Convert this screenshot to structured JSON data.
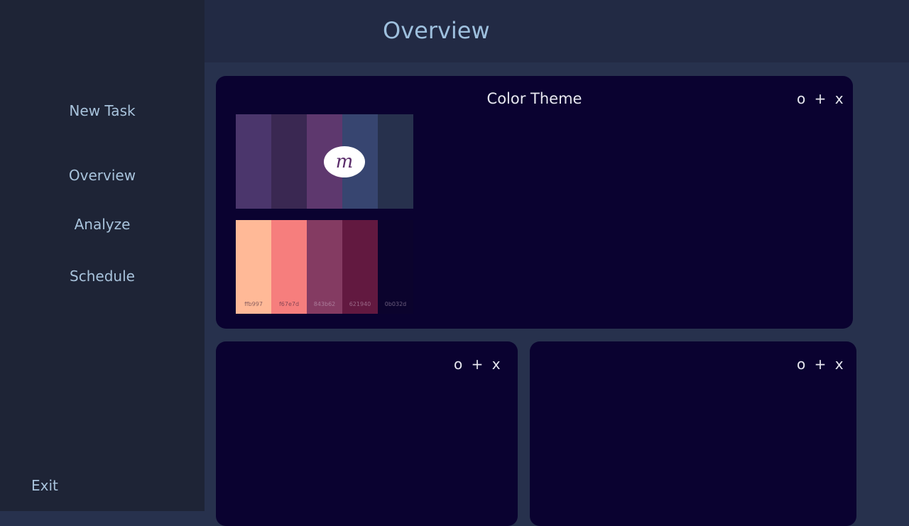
{
  "sidebar": {
    "items": [
      {
        "label": "New Task"
      },
      {
        "label": "Overview"
      },
      {
        "label": "Analyze"
      },
      {
        "label": "Schedule"
      }
    ],
    "exit_label": "Exit"
  },
  "header": {
    "title": "Overview"
  },
  "panels": {
    "color_theme": {
      "title": "Color Theme",
      "controls": {
        "minimize": "o",
        "add": "+",
        "close": "x"
      },
      "logo_letter": "m",
      "palette_top": [
        "#4b366c",
        "#3a2852",
        "#5e386e",
        "#374570",
        "#27314d"
      ],
      "palette_bottom": [
        {
          "color": "#ffb997",
          "hex": "ffb997"
        },
        {
          "color": "#f67e7d",
          "hex": "f67e7d"
        },
        {
          "color": "#843b62",
          "hex": "843b62"
        },
        {
          "color": "#621940",
          "hex": "621940"
        },
        {
          "color": "#0b032d",
          "hex": "0b032d"
        }
      ]
    },
    "left_panel": {
      "controls": {
        "minimize": "o",
        "add": "+",
        "close": "x"
      }
    },
    "right_panel": {
      "controls": {
        "minimize": "o",
        "add": "+",
        "close": "x"
      }
    }
  }
}
